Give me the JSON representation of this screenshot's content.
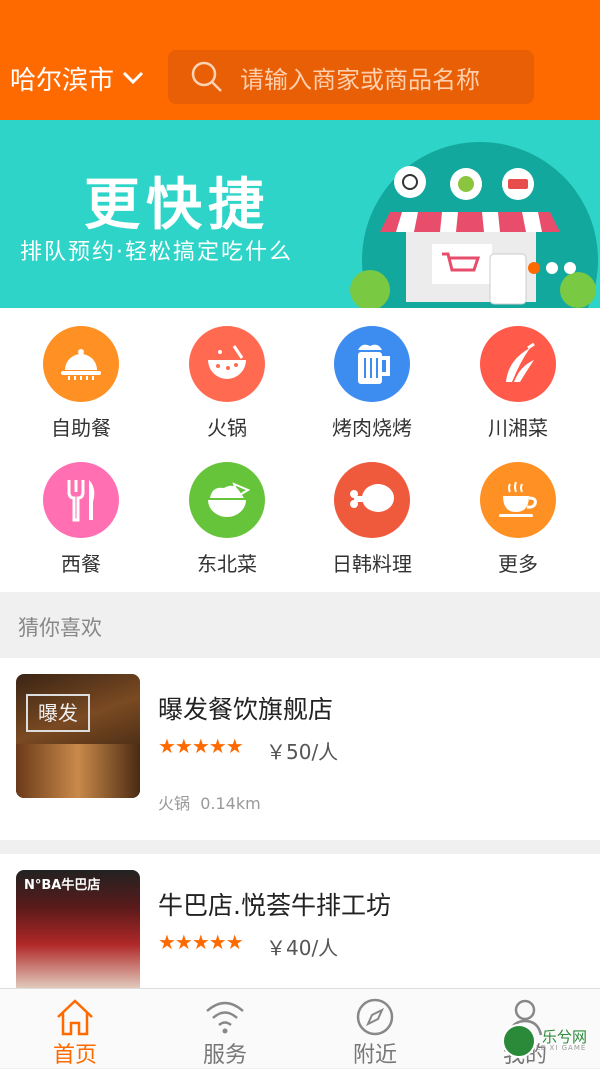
{
  "header": {
    "city": "哈尔滨市",
    "search_placeholder": "请输入商家或商品名称"
  },
  "banner": {
    "title": "更快捷",
    "subtitle": "排队预约·轻松搞定吃什么",
    "slide_count": 3,
    "active_slide": 1
  },
  "categories": [
    {
      "label": "自助餐",
      "icon": "cloche-icon",
      "color": "#ff9124"
    },
    {
      "label": "火锅",
      "icon": "hotpot-bowl-icon",
      "color": "#ff6a50"
    },
    {
      "label": "烤肉烧烤",
      "icon": "beer-mug-icon",
      "color": "#3d8cf0"
    },
    {
      "label": "川湘菜",
      "icon": "chili-pepper-icon",
      "color": "#ff5a4a"
    },
    {
      "label": "西餐",
      "icon": "fork-knife-icon",
      "color": "#ff6fb1"
    },
    {
      "label": "东北菜",
      "icon": "rice-bowl-icon",
      "color": "#66c43a"
    },
    {
      "label": "日韩料理",
      "icon": "drumstick-icon",
      "color": "#f05a3c"
    },
    {
      "label": "更多",
      "icon": "coffee-cup-icon",
      "color": "#ff9124"
    }
  ],
  "section_title": "猜你喜欢",
  "shops": [
    {
      "name": "曝发餐饮旗舰店",
      "rating": "★★★★★",
      "price": "￥50/人",
      "category": "火锅",
      "distance": "0.14km",
      "thumb_text": "曝发"
    },
    {
      "name": "牛巴店.悦荟牛排工坊",
      "rating": "★★★★★",
      "price": "￥40/人",
      "category": "",
      "distance": "",
      "thumb_text": "N°BA牛巴店"
    }
  ],
  "tabs": [
    {
      "label": "首页",
      "icon": "home-icon",
      "active": true
    },
    {
      "label": "服务",
      "icon": "wifi-icon",
      "active": false
    },
    {
      "label": "附近",
      "icon": "compass-icon",
      "active": false
    },
    {
      "label": "我的",
      "icon": "user-icon",
      "active": false
    }
  ],
  "watermark": {
    "text": "乐兮网",
    "sub": "LE XI GAME"
  },
  "colors": {
    "brand": "#ff6a00",
    "banner_bg": "#2fd4c8"
  }
}
